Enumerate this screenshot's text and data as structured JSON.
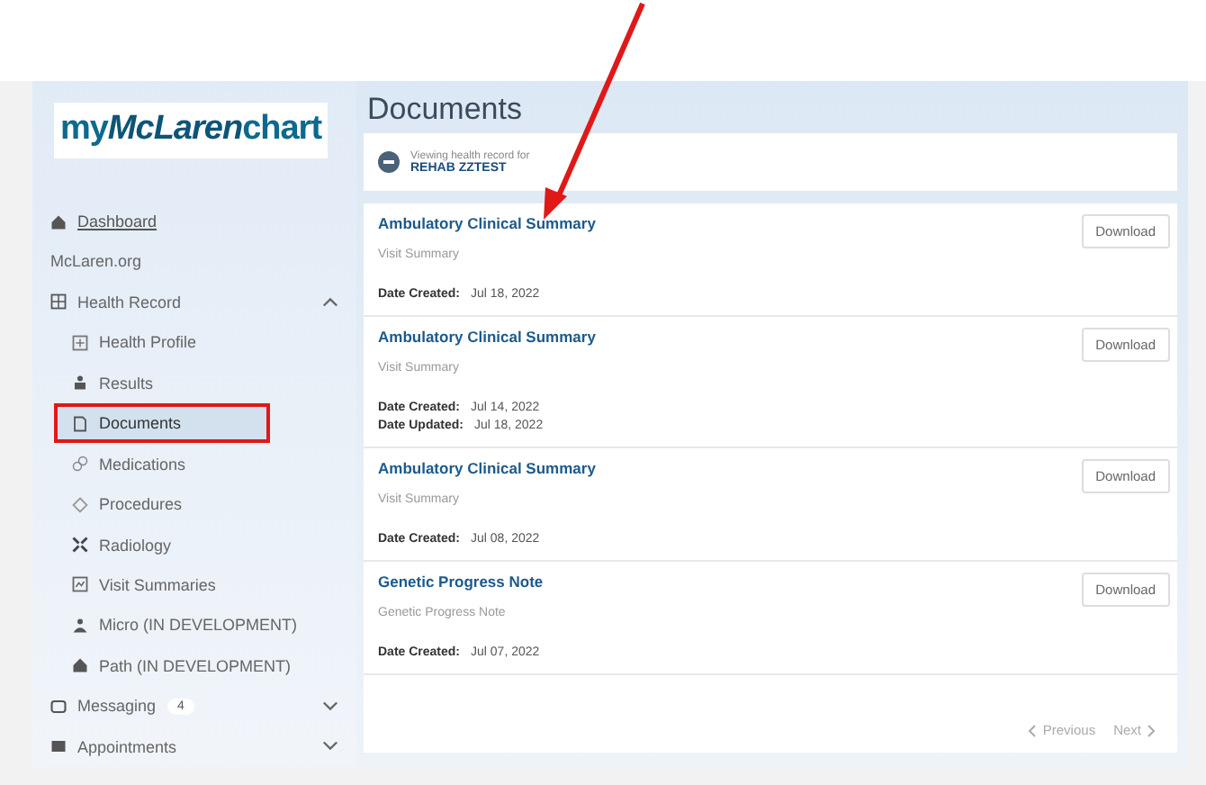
{
  "logo": {
    "prefix": "my",
    "brand": "McLaren",
    "suffix": "chart"
  },
  "sidebar": {
    "items": [
      {
        "kind": "link",
        "label": "Dashboard"
      },
      {
        "kind": "plain",
        "label": "McLaren.org"
      },
      {
        "kind": "group",
        "label": "Health Record",
        "expanded": true,
        "children": [
          {
            "label": "Health Profile",
            "selected": false
          },
          {
            "label": "Results",
            "selected": false
          },
          {
            "label": "Documents",
            "selected": true
          },
          {
            "label": "Medications",
            "selected": false
          },
          {
            "label": "Procedures",
            "selected": false
          },
          {
            "label": "Radiology",
            "selected": false
          },
          {
            "label": "Visit Summaries",
            "selected": false
          },
          {
            "label": "Micro (IN DEVELOPMENT)",
            "selected": false
          },
          {
            "label": "Path (IN DEVELOPMENT)",
            "selected": false
          }
        ]
      },
      {
        "kind": "group",
        "label": "Messaging",
        "badge": "4",
        "expanded": false
      },
      {
        "kind": "group",
        "label": "Appointments",
        "expanded": false
      }
    ]
  },
  "page_title": "Documents",
  "patient_banner": {
    "caption": "Viewing health record for",
    "name": "REHAB ZZTEST"
  },
  "documents": [
    {
      "title": "Ambulatory Clinical Summary",
      "type": "Visit Summary",
      "dates": [
        {
          "label": "Date Created:",
          "value": "Jul 18, 2022"
        }
      ],
      "button": "Download"
    },
    {
      "title": "Ambulatory Clinical Summary",
      "type": "Visit Summary",
      "dates": [
        {
          "label": "Date Created:",
          "value": "Jul 14, 2022"
        },
        {
          "label": "Date Updated:",
          "value": "Jul 18, 2022"
        }
      ],
      "button": "Download"
    },
    {
      "title": "Ambulatory Clinical Summary",
      "type": "Visit Summary",
      "dates": [
        {
          "label": "Date Created:",
          "value": "Jul 08, 2022"
        }
      ],
      "button": "Download"
    },
    {
      "title": "Genetic Progress Note",
      "type": "Genetic Progress Note",
      "dates": [
        {
          "label": "Date Created:",
          "value": "Jul 07, 2022"
        }
      ],
      "button": "Download"
    }
  ],
  "pagination": {
    "previous": "Previous",
    "next": "Next"
  }
}
